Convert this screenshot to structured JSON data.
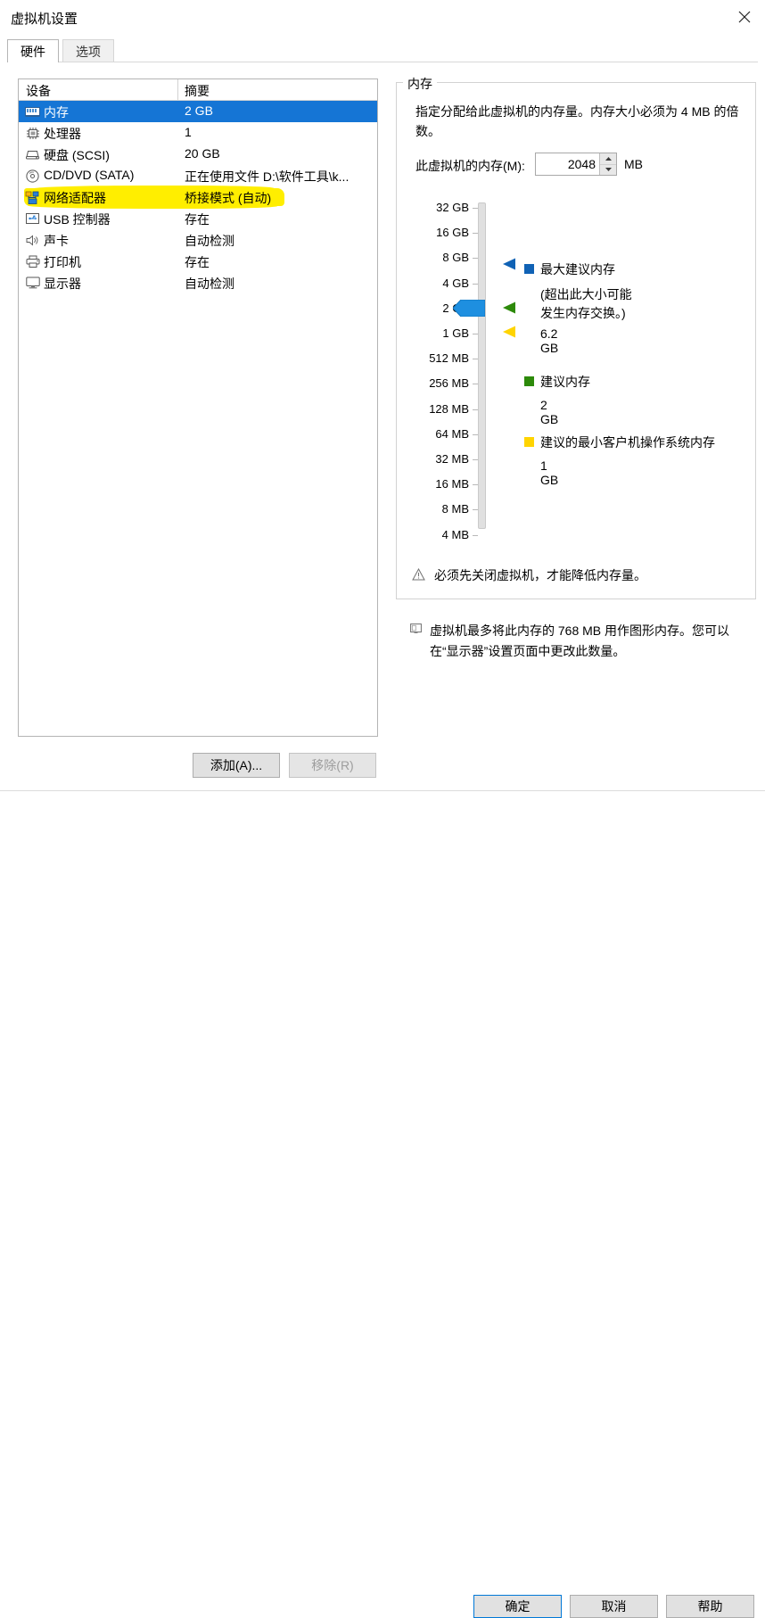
{
  "window": {
    "title": "虚拟机设置",
    "close_label": "✕"
  },
  "tabs": [
    {
      "label": "硬件",
      "active": true
    },
    {
      "label": "选项",
      "active": false
    }
  ],
  "device_list": {
    "columns": [
      "设备",
      "摘要"
    ],
    "rows": [
      {
        "icon": "memory-icon",
        "name": "内存",
        "summary": "2 GB",
        "selected": true,
        "highlighted": false
      },
      {
        "icon": "processor-icon",
        "name": "处理器",
        "summary": "1",
        "selected": false,
        "highlighted": false
      },
      {
        "icon": "harddisk-icon",
        "name": "硬盘 (SCSI)",
        "summary": "20 GB",
        "selected": false,
        "highlighted": false
      },
      {
        "icon": "cddvd-icon",
        "name": "CD/DVD (SATA)",
        "summary": "正在使用文件 D:\\软件工具\\k...",
        "selected": false,
        "highlighted": false
      },
      {
        "icon": "network-adapter-icon",
        "name": "网络适配器",
        "summary": "桥接模式 (自动)",
        "selected": false,
        "highlighted": true
      },
      {
        "icon": "usb-controller-icon",
        "name": "USB 控制器",
        "summary": "存在",
        "selected": false,
        "highlighted": false
      },
      {
        "icon": "sound-card-icon",
        "name": "声卡",
        "summary": "自动检测",
        "selected": false,
        "highlighted": false
      },
      {
        "icon": "printer-icon",
        "name": "打印机",
        "summary": "存在",
        "selected": false,
        "highlighted": false
      },
      {
        "icon": "display-icon",
        "name": "显示器",
        "summary": "自动检测",
        "selected": false,
        "highlighted": false
      }
    ]
  },
  "list_buttons": {
    "add": "添加(A)...",
    "remove": "移除(R)"
  },
  "memory_panel": {
    "group_title": "内存",
    "description": "指定分配给此虚拟机的内存量。内存大小必须为 4 MB 的倍数。",
    "field_label": "此虚拟机的内存(M):",
    "field_value": "2048",
    "field_unit": "MB",
    "spin_up": "▲",
    "spin_down": "▼"
  },
  "chart_data": {
    "type": "scale",
    "title": "内存",
    "tick_labels": [
      "32 GB",
      "16 GB",
      "8 GB",
      "4 GB",
      "2 GB",
      "1 GB",
      "512 MB",
      "256 MB",
      "128 MB",
      "64 MB",
      "32 MB",
      "16 MB",
      "8 MB",
      "4 MB"
    ],
    "current_value_mb": 2048,
    "current_tick": "2 GB",
    "markers": [
      {
        "name": "最大建议内存",
        "color": "#1062b5",
        "value": "6.2 GB",
        "tick_position": "between 8 GB and 4 GB"
      },
      {
        "name": "建议内存",
        "color": "#2d8a0a",
        "value": "2 GB",
        "tick_position": "2 GB"
      },
      {
        "name": "建议的最小客户机操作系统内存",
        "color": "#ffd400",
        "value": "1 GB",
        "tick_position": "1 GB"
      }
    ]
  },
  "legend": {
    "max_recommended": {
      "label": "最大建议内存",
      "note": "(超出此大小可能\n发生内存交换。)",
      "value": "6.2 GB",
      "color": "#1062b5"
    },
    "recommended": {
      "label": "建议内存",
      "value": "2 GB",
      "color": "#2d8a0a"
    },
    "minimum_guest": {
      "label": "建议的最小客户机操作系统内存",
      "value": "1 GB",
      "color": "#ffd400"
    }
  },
  "notes": {
    "warning_icon": "warning-triangle-icon",
    "warning_text": "必须先关闭虚拟机，才能降低内存量。",
    "info_icon": "display-info-icon",
    "info_text": "虚拟机最多将此内存的 768 MB 用作图形内存。您可以在“显示器”设置页面中更改此数量。"
  },
  "footer_buttons": {
    "ok": "确定",
    "cancel": "取消",
    "help": "帮助"
  },
  "colors": {
    "selection_blue": "#1575d5",
    "highlight_yellow": "#ffee00",
    "focus_blue": "#0078d7"
  }
}
